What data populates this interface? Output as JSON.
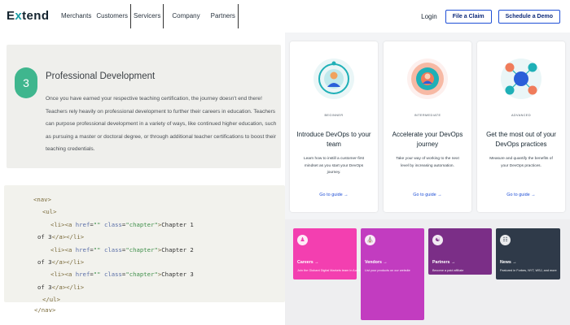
{
  "header": {
    "logo": "Extend",
    "nav": [
      "Merchants",
      "Customers",
      "Servicers",
      "Company",
      "Partners"
    ],
    "login": "Login",
    "file_claim": "File a Claim",
    "schedule_demo": "Schedule a Demo"
  },
  "pd": {
    "number": "3",
    "title": "Professional Development",
    "body": "Once you have earned your respective teaching certification, the journey doesn't end there! Teachers rely heavily on professional development to further their careers in education. Teachers can purpose professional development in a variety of ways, like continued higher education, such as pursuing a master or doctoral degree, or through additional teacher certifications to boost their teaching credentials."
  },
  "code": {
    "nav_open": "<nav>",
    "ul_open": "<ul>",
    "li_open": "<li>",
    "a_open": "<a ",
    "href_attr": "href",
    "href_val": "\"\"",
    "class_attr": "class",
    "class_val": "\"chapter\"",
    "tag_close": ">",
    "chapter1": "Chapter 1",
    "chapter2": "Chapter 2",
    "chapter3": "Chapter 3",
    "of3": "of 3",
    "a_close": "</a>",
    "li_close": "</li>",
    "ul_close": "</ul>",
    "nav_close": "</nav>"
  },
  "cards": [
    {
      "level": "BEGINNER",
      "title": "Introduce DevOps to your team",
      "desc": "Learn how to instill a customer-first mindset as you start your DevOps journey.",
      "link": "Go to guide →"
    },
    {
      "level": "INTERMEDIATE",
      "title": "Accelerate your DevOps journey",
      "desc": "Take your way of working to the next level by increasing automation.",
      "link": "Go to guide →"
    },
    {
      "level": "ADVANCED",
      "title": "Get the most out of your DevOps practices",
      "desc": "Measure and quantify the benefits of your DevOps practices.",
      "link": "Go to guide →"
    }
  ],
  "tiles": [
    {
      "name": "Careers →",
      "desc": "Join the Globant Digital Markets team in Austin",
      "color": "#f33fb0",
      "icon": "people-icon"
    },
    {
      "name": "Vendors →",
      "desc": "List your products on our website",
      "color": "#c23cc0",
      "icon": "store-icon"
    },
    {
      "name": "Partners →",
      "desc": "Become a paid affiliate",
      "color": "#7b2e87",
      "icon": "handshake-icon"
    },
    {
      "name": "News →",
      "desc": "Featured in Forbes, NYT, WSJ, and more",
      "color": "#2f3a49",
      "icon": "newspaper-icon"
    }
  ],
  "colors": {
    "accent_teal": "#1b9ea6",
    "badge_green": "#3fb68e",
    "link_blue": "#1f4fd6"
  }
}
